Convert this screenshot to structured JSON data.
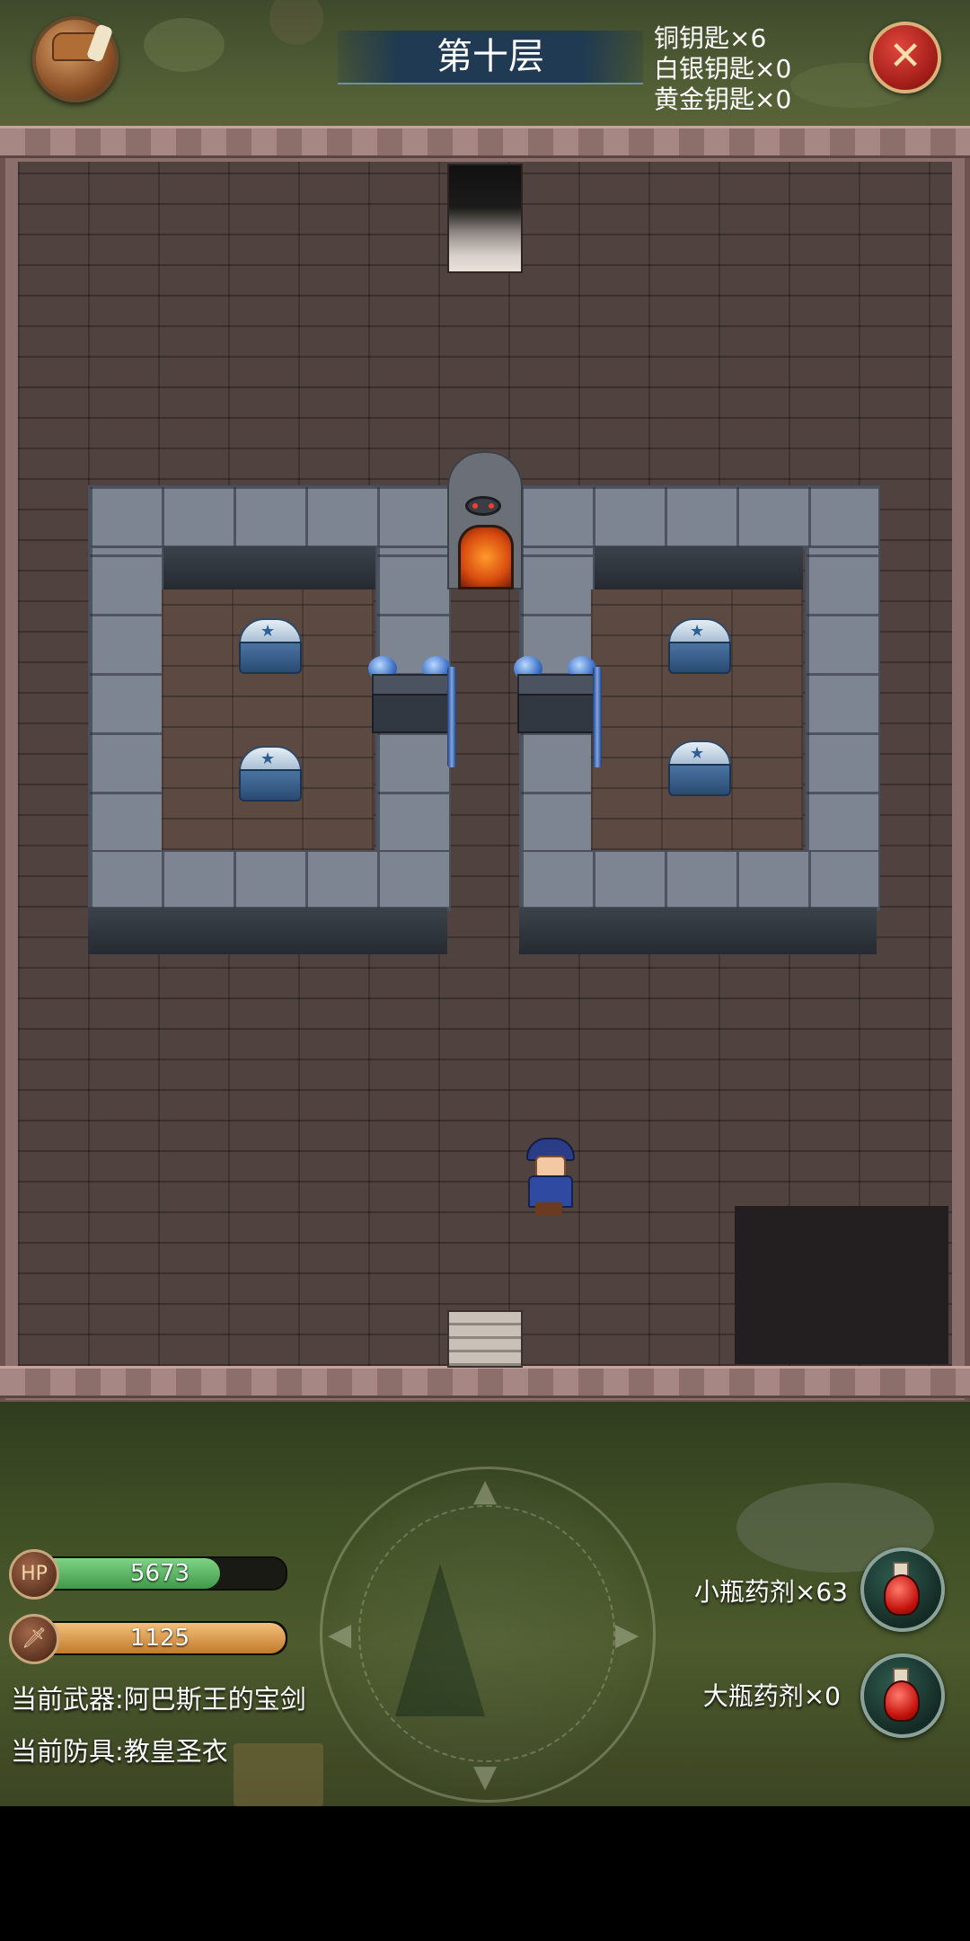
{
  "header": {
    "floor_title": "第十层",
    "keys": {
      "bronze": "铜钥匙×6",
      "silver": "白银钥匙×0",
      "gold": "黄金钥匙×0"
    },
    "close_icon": "close-icon",
    "backpack_icon": "backpack-icon"
  },
  "stats": {
    "hp_label": "HP",
    "hp_value": "5673",
    "hp_fill_fraction": 0.74,
    "atk_icon": "sword-icon",
    "atk_value": "1125",
    "atk_fill_fraction": 1.0
  },
  "equipment": {
    "weapon": "当前武器:阿巴斯王的宝剑",
    "armor": "当前防具:教皇圣衣"
  },
  "potions": {
    "small": "小瓶药剂×63",
    "large": "大瓶药剂×0"
  },
  "colors": {
    "hp_bar": "#4fb05a",
    "atk_bar": "#e0a65a",
    "floor_title_bg": "#1f3a52"
  }
}
